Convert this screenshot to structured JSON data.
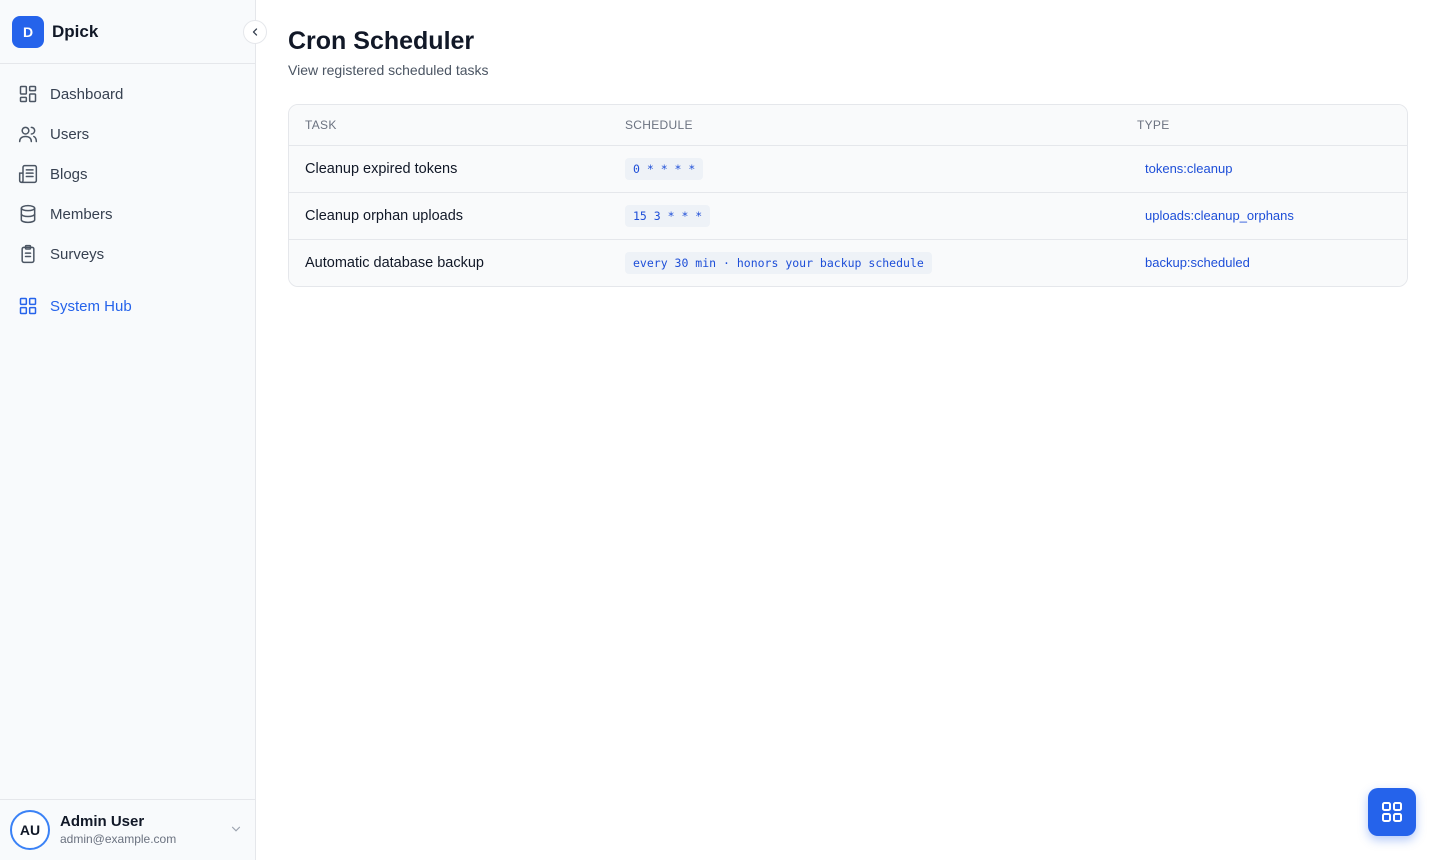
{
  "brand": {
    "logo_letter": "D",
    "name": "Dpick"
  },
  "sidebar": {
    "items": [
      {
        "label": "Dashboard",
        "icon": "dashboard-icon"
      },
      {
        "label": "Users",
        "icon": "users-icon"
      },
      {
        "label": "Blogs",
        "icon": "newspaper-icon"
      },
      {
        "label": "Members",
        "icon": "database-icon"
      },
      {
        "label": "Surveys",
        "icon": "clipboard-icon"
      }
    ],
    "system_hub": {
      "label": "System Hub",
      "icon": "grid-icon",
      "active": true
    }
  },
  "user": {
    "initials": "AU",
    "name": "Admin User",
    "email": "admin@example.com"
  },
  "page": {
    "title": "Cron Scheduler",
    "subtitle": "View registered scheduled tasks"
  },
  "table": {
    "headers": {
      "task": "TASK",
      "schedule": "SCHEDULE",
      "type": "TYPE"
    },
    "rows": [
      {
        "task": "Cleanup expired tokens",
        "schedule": "0 * * * *",
        "type": "tokens:cleanup"
      },
      {
        "task": "Cleanup orphan uploads",
        "schedule": "15 3 * * *",
        "type": "uploads:cleanup_orphans"
      },
      {
        "task": "Automatic database backup",
        "schedule": "every 30 min · honors your backup schedule",
        "type": "backup:scheduled"
      }
    ]
  },
  "colors": {
    "accent": "#2563eb",
    "code_text": "#1d4ed8",
    "sidebar_bg": "#f8fafc"
  },
  "fab": {
    "icon": "grid-icon"
  }
}
